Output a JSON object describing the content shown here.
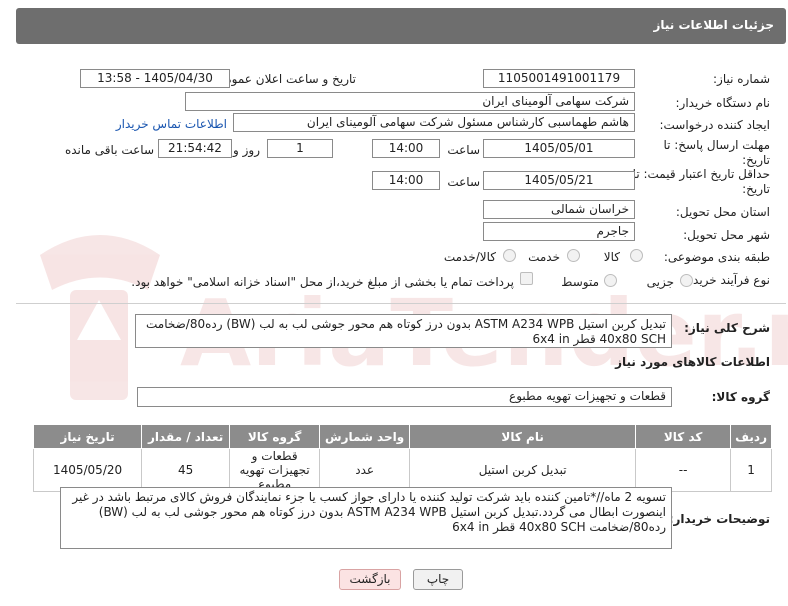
{
  "header": {
    "title": "جزئیات اطلاعات نیاز"
  },
  "fields": {
    "need_number_label": "شماره نیاز:",
    "need_number": "1105001491001179",
    "announce_label": "تاریخ و ساعت اعلان عمومی:",
    "announce_value": "1405/04/30 - 13:58",
    "buyer_label": "نام دستگاه خریدار:",
    "buyer_value": "شرکت سهامی آلومینای ایران",
    "requester_label": "ایجاد کننده درخواست:",
    "requester_value": "هاشم طهماسبی کارشناس مسئول شرکت سهامی آلومینای ایران",
    "contact_link": "اطلاعات تماس خریدار",
    "deadline_label": "مهلت ارسال پاسخ: تا تاریخ:",
    "deadline_date": "1405/05/01",
    "time_label": "ساعت",
    "deadline_time": "14:00",
    "days_value": "1",
    "days_label": "روز و",
    "remaining_time": "21:54:42",
    "remaining_label": "ساعت باقی مانده",
    "validity_label": "حداقل تاریخ اعتبار قیمت: تا تاریخ:",
    "validity_date": "1405/05/21",
    "validity_time": "14:00",
    "province_label": "استان محل تحویل:",
    "province_value": "خراسان شمالی",
    "city_label": "شهر محل تحویل:",
    "city_value": "جاجرم",
    "category_label": "طبقه بندی موضوعی:",
    "category_options": [
      "کالا",
      "خدمت",
      "کالا/خدمت"
    ],
    "process_label": "نوع فرآیند خرید :",
    "process_options": [
      "جزیی",
      "متوسط"
    ],
    "payment_note": "پرداخت تمام یا بخشی از مبلغ خرید،از محل \"اسناد خزانه اسلامی\" خواهد بود."
  },
  "description": {
    "label": "شرح کلی نیاز:",
    "text": "تبدیل کربن استیل ASTM A234 WPB بدون درز کوتاه هم محور جوشی لب به لب (BW) رده80/ضخامت 40x80 SCH قطر 6x4 in"
  },
  "goods_info": {
    "title": "اطلاعات کالاهای مورد نیاز",
    "group_label": "گروه کالا:",
    "group_value": "قطعات و تجهیزات تهویه مطبوع"
  },
  "table": {
    "columns": [
      "ردیف",
      "کد کالا",
      "نام کالا",
      "واحد شمارش",
      "گروه کالا",
      "تعداد / مقدار",
      "تاریخ نیاز"
    ],
    "rows": [
      {
        "row": "1",
        "code": "--",
        "name": "تبدیل کربن استیل",
        "unit": "عدد",
        "group": "قطعات و تجهیزات تهویه مطبوع",
        "qty": "45",
        "date": "1405/05/20"
      }
    ]
  },
  "buyer_notes": {
    "label": "توضیحات خریدار:",
    "text": "تسویه 2 ماه//*تامین کننده باید شرکت تولید کننده یا دارای جواز کسب یا جزء نمایندگان فروش کالای مرتبط باشد در غیر اینصورت ابطال می گردد.تبدیل کربن استیل ASTM A234 WPB بدون درز کوتاه هم محور جوشی لب به لب (BW) رده80/ضخامت 40x80 SCH قطر 6x4 in"
  },
  "buttons": {
    "print": "چاپ",
    "back": "بازگشت"
  },
  "watermark": "AriaTender.net",
  "colors": {
    "header_bg": "#6e6e6e",
    "link": "#1a56b0",
    "back_bg": "#fbe3e3",
    "print_bg": "#f1f1f1"
  }
}
